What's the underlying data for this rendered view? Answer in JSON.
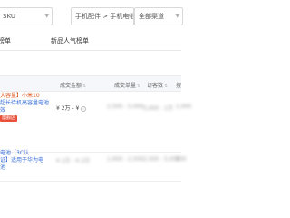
{
  "filters": {
    "sku_select": "SKU",
    "category_select": "手机配件 > 手机电池",
    "channel_select": "全部渠道"
  },
  "tabs": [
    "榜单",
    "新品人气榜单"
  ],
  "table": {
    "columns": [
      "成交金额",
      "成交单量",
      "访客数",
      "搜"
    ],
    "rows": [
      {
        "name_lines": [
          "大容量】小米10",
          "超长待机高容量电池",
          "效"
        ],
        "tag": "旗舰店",
        "amount": "¥ 2万 - ¥",
        "orders": "2,500 - 5,000",
        "visitors": "5,000 - 1万",
        "search": "1,000"
      },
      {
        "name_lines": [
          "电池【3C认",
          "证】适用于华为电",
          "池"
        ],
        "tag": "",
        "amount": "¥ 1万 - ¥ 2万",
        "orders": "1,000 - 2,500",
        "visitors": "2,500 - 5,000",
        "search": "500"
      }
    ]
  },
  "colors": {
    "link": "#3a6fd8",
    "brand": "#e0531a",
    "tag_bg": "#e9503a",
    "header_bg": "#f5f7fa"
  },
  "icons": {
    "dropdown": "chevron-down-icon",
    "sort": "sort-icon",
    "info": "info-icon"
  }
}
